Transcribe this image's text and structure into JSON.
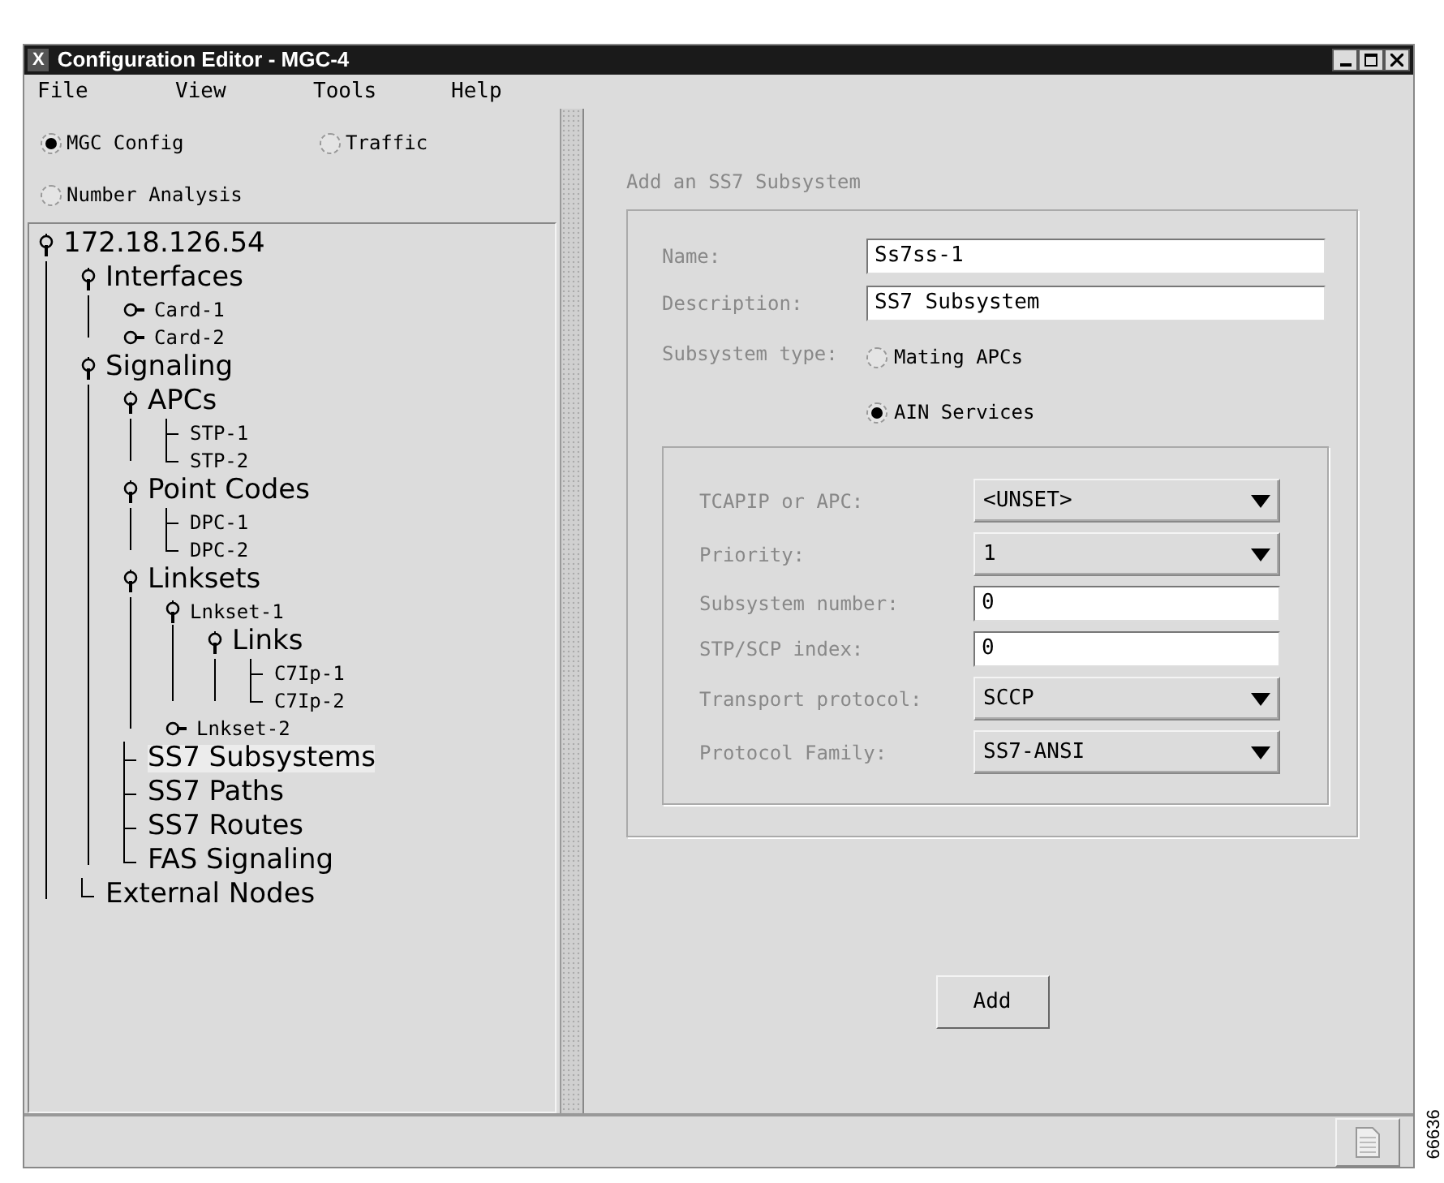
{
  "window": {
    "title": "Configuration Editor - MGC-4",
    "app_icon": "X"
  },
  "menu": [
    "File",
    "View",
    "Tools",
    "Help"
  ],
  "modes": [
    {
      "label": "MGC Config",
      "selected": true
    },
    {
      "label": "Traffic",
      "selected": false
    },
    {
      "label": "Number Analysis",
      "selected": false
    }
  ],
  "tree": [
    {
      "label": "172.18.126.54",
      "kind": "category",
      "expanded": true,
      "selected": false,
      "children": [
        {
          "label": "Interfaces",
          "kind": "category",
          "expanded": true,
          "selected": false,
          "children": [
            {
              "label": "Card-1",
              "kind": "entry",
              "expanded": false,
              "selected": false
            },
            {
              "label": "Card-2",
              "kind": "entry",
              "expanded": false,
              "selected": false
            }
          ]
        },
        {
          "label": "Signaling",
          "kind": "category",
          "expanded": true,
          "selected": false,
          "children": [
            {
              "label": "APCs",
              "kind": "category",
              "expanded": true,
              "selected": false,
              "children": [
                {
                  "label": "STP-1",
                  "kind": "entry",
                  "selected": false
                },
                {
                  "label": "STP-2",
                  "kind": "entry",
                  "selected": false
                }
              ]
            },
            {
              "label": "Point Codes",
              "kind": "category",
              "expanded": true,
              "selected": false,
              "children": [
                {
                  "label": "DPC-1",
                  "kind": "entry",
                  "selected": false
                },
                {
                  "label": "DPC-2",
                  "kind": "entry",
                  "selected": false
                }
              ]
            },
            {
              "label": "Linksets",
              "kind": "category",
              "expanded": true,
              "selected": false,
              "children": [
                {
                  "label": "Lnkset-1",
                  "kind": "entry",
                  "expanded": true,
                  "selected": false,
                  "children": [
                    {
                      "label": "Links",
                      "kind": "category",
                      "expanded": true,
                      "selected": false,
                      "children": [
                        {
                          "label": "C7Ip-1",
                          "kind": "entry",
                          "selected": false
                        },
                        {
                          "label": "C7Ip-2",
                          "kind": "entry",
                          "selected": false
                        }
                      ]
                    }
                  ]
                },
                {
                  "label": "Lnkset-2",
                  "kind": "entry",
                  "expanded": false,
                  "selected": false
                }
              ]
            },
            {
              "label": "SS7 Subsystems",
              "kind": "category",
              "selected": true
            },
            {
              "label": "SS7 Paths",
              "kind": "category",
              "selected": false
            },
            {
              "label": "SS7 Routes",
              "kind": "category",
              "selected": false
            },
            {
              "label": "FAS Signaling",
              "kind": "category",
              "selected": false
            }
          ]
        },
        {
          "label": "External Nodes",
          "kind": "category",
          "selected": false
        }
      ]
    }
  ],
  "form": {
    "title": "Add an SS7 Subsystem",
    "name": {
      "label": "Name:",
      "value": "Ss7ss-1"
    },
    "description": {
      "label": "Description:",
      "value": "SS7 Subsystem"
    },
    "subsystem_type": {
      "label": "Subsystem type:",
      "options": [
        {
          "label": "Mating APCs",
          "selected": false
        },
        {
          "label": "AIN Services",
          "selected": true
        }
      ]
    },
    "details": [
      {
        "label": "TCAPIP or APC:",
        "kind": "dropdown",
        "value": "<UNSET>"
      },
      {
        "label": "Priority:",
        "kind": "dropdown",
        "value": "1"
      },
      {
        "label": "Subsystem number:",
        "kind": "text",
        "value": "0"
      },
      {
        "label": "STP/SCP index:",
        "kind": "text",
        "value": "0"
      },
      {
        "label": "Transport protocol:",
        "kind": "dropdown",
        "value": "SCCP"
      },
      {
        "label": "Protocol Family:",
        "kind": "dropdown",
        "value": "SS7-ANSI"
      }
    ],
    "button": "Add"
  },
  "figure_number": "66636"
}
